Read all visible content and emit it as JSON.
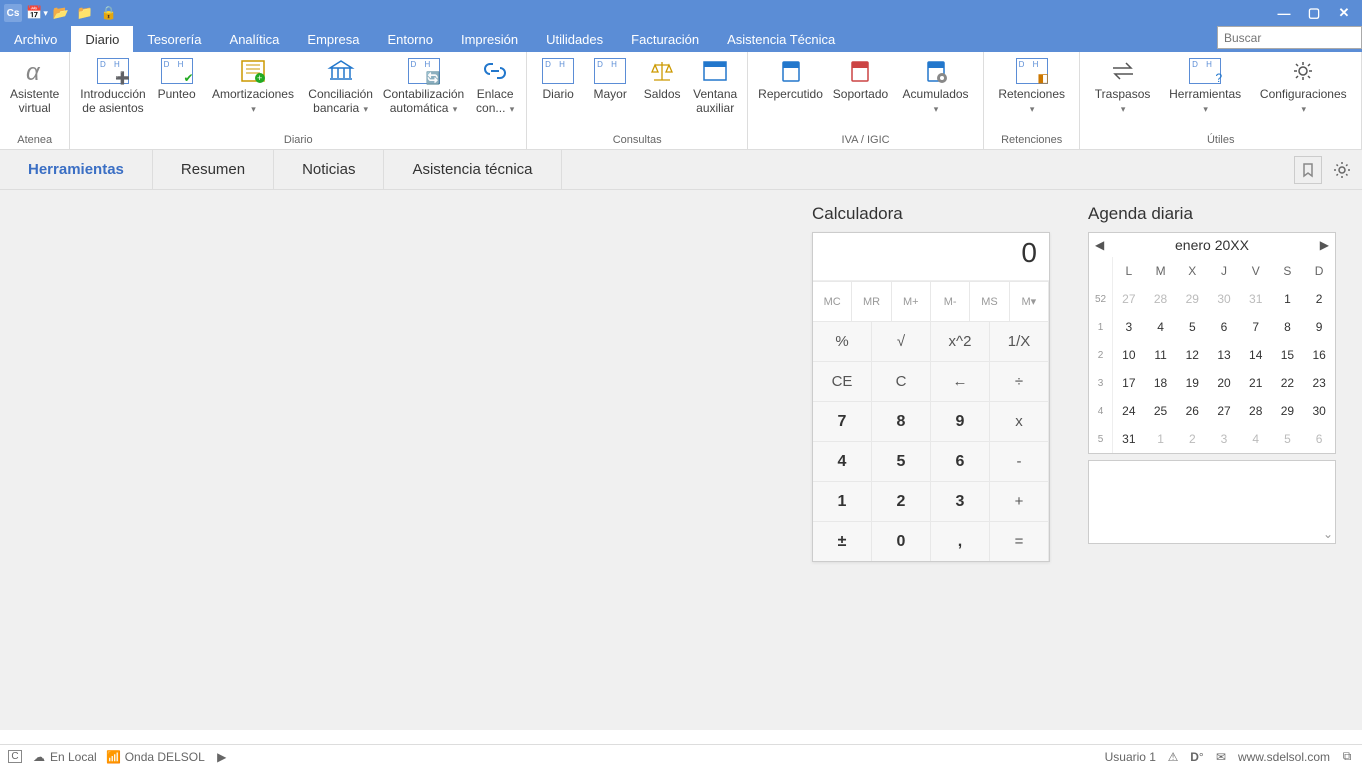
{
  "titlebar": {
    "app": "Cs"
  },
  "menu": {
    "items": [
      "Archivo",
      "Diario",
      "Tesorería",
      "Analítica",
      "Empresa",
      "Entorno",
      "Impresión",
      "Utilidades",
      "Facturación",
      "Asistencia Técnica"
    ],
    "active": 1
  },
  "search": {
    "placeholder": "Buscar"
  },
  "ribbon": {
    "groups": [
      {
        "label": "Atenea",
        "buttons": [
          {
            "label": "Asistente\nvirtual",
            "icon": "alpha"
          }
        ]
      },
      {
        "label": "Diario",
        "buttons": [
          {
            "label": "Introducción\nde asientos",
            "icon": "dh-plus"
          },
          {
            "label": "Punteo",
            "icon": "dh-check"
          },
          {
            "label": "Amortizaciones",
            "icon": "amort",
            "dd": true
          },
          {
            "label": "Conciliación\nbancaria",
            "icon": "bank",
            "dd": true
          },
          {
            "label": "Contabilización\nautomática",
            "icon": "dh-cycle",
            "dd": true
          },
          {
            "label": "Enlace\ncon...",
            "icon": "link",
            "dd": true
          }
        ]
      },
      {
        "label": "Consultas",
        "buttons": [
          {
            "label": "Diario",
            "icon": "dh"
          },
          {
            "label": "Mayor",
            "icon": "dh"
          },
          {
            "label": "Saldos",
            "icon": "scale"
          },
          {
            "label": "Ventana\nauxiliar",
            "icon": "window"
          }
        ]
      },
      {
        "label": "IVA / IGIC",
        "buttons": [
          {
            "label": "Repercutido",
            "icon": "book-blue"
          },
          {
            "label": "Soportado",
            "icon": "book-red"
          },
          {
            "label": "Acumulados",
            "icon": "book-gear",
            "dd": true
          }
        ]
      },
      {
        "label": "Retenciones",
        "buttons": [
          {
            "label": "Retenciones",
            "icon": "dh-ret",
            "dd": true
          }
        ]
      },
      {
        "label": "Útiles",
        "buttons": [
          {
            "label": "Traspasos",
            "icon": "transfer",
            "dd": true
          },
          {
            "label": "Herramientas",
            "icon": "dh-q",
            "dd": true
          },
          {
            "label": "Configuraciones",
            "icon": "gear",
            "dd": true
          }
        ]
      }
    ]
  },
  "subtabs": {
    "items": [
      "Herramientas",
      "Resumen",
      "Noticias",
      "Asistencia técnica"
    ],
    "active": 0
  },
  "calculator": {
    "title": "Calculadora",
    "display": "0",
    "mem": [
      "MC",
      "MR",
      "M+",
      "M-",
      "MS",
      "M▾"
    ],
    "row1": [
      "%",
      "√",
      "x^2",
      "1/X"
    ],
    "row2": [
      "CE",
      "C",
      "←",
      "÷"
    ],
    "row3": [
      "7",
      "8",
      "9",
      "x"
    ],
    "row4": [
      "4",
      "5",
      "6",
      "-"
    ],
    "row5": [
      "1",
      "2",
      "3",
      "+"
    ],
    "row6": [
      "±",
      "0",
      ",",
      "="
    ]
  },
  "agenda": {
    "title": "Agenda diaria",
    "month": "enero 20XX",
    "dow": [
      "L",
      "M",
      "X",
      "J",
      "V",
      "S",
      "D"
    ],
    "weeks": [
      {
        "wk": "52",
        "days": [
          27,
          28,
          29,
          30,
          31,
          1,
          2
        ],
        "cur": [
          false,
          false,
          false,
          false,
          false,
          true,
          true
        ]
      },
      {
        "wk": "1",
        "days": [
          3,
          4,
          5,
          6,
          7,
          8,
          9
        ],
        "cur": [
          true,
          true,
          true,
          true,
          true,
          true,
          true
        ]
      },
      {
        "wk": "2",
        "days": [
          10,
          11,
          12,
          13,
          14,
          15,
          16
        ],
        "cur": [
          true,
          true,
          true,
          true,
          true,
          true,
          true
        ]
      },
      {
        "wk": "3",
        "days": [
          17,
          18,
          19,
          20,
          21,
          22,
          23
        ],
        "cur": [
          true,
          true,
          true,
          true,
          true,
          true,
          true
        ]
      },
      {
        "wk": "4",
        "days": [
          24,
          25,
          26,
          27,
          28,
          29,
          30
        ],
        "cur": [
          true,
          true,
          true,
          true,
          true,
          true,
          true
        ]
      },
      {
        "wk": "5",
        "days": [
          31,
          1,
          2,
          3,
          4,
          5,
          6
        ],
        "cur": [
          true,
          false,
          false,
          false,
          false,
          false,
          false
        ]
      }
    ]
  },
  "status": {
    "left": [
      {
        "icon": "C",
        "label": ""
      },
      {
        "icon": "cloud",
        "label": "En Local"
      },
      {
        "icon": "wifi",
        "label": "Onda DELSOL"
      },
      {
        "icon": "play",
        "label": ""
      }
    ],
    "right": [
      {
        "label": "Usuario 1"
      },
      {
        "icon": "warn"
      },
      {
        "icon": "D"
      },
      {
        "icon": "mail"
      },
      {
        "label": "www.sdelsol.com"
      },
      {
        "icon": "copy"
      }
    ]
  }
}
